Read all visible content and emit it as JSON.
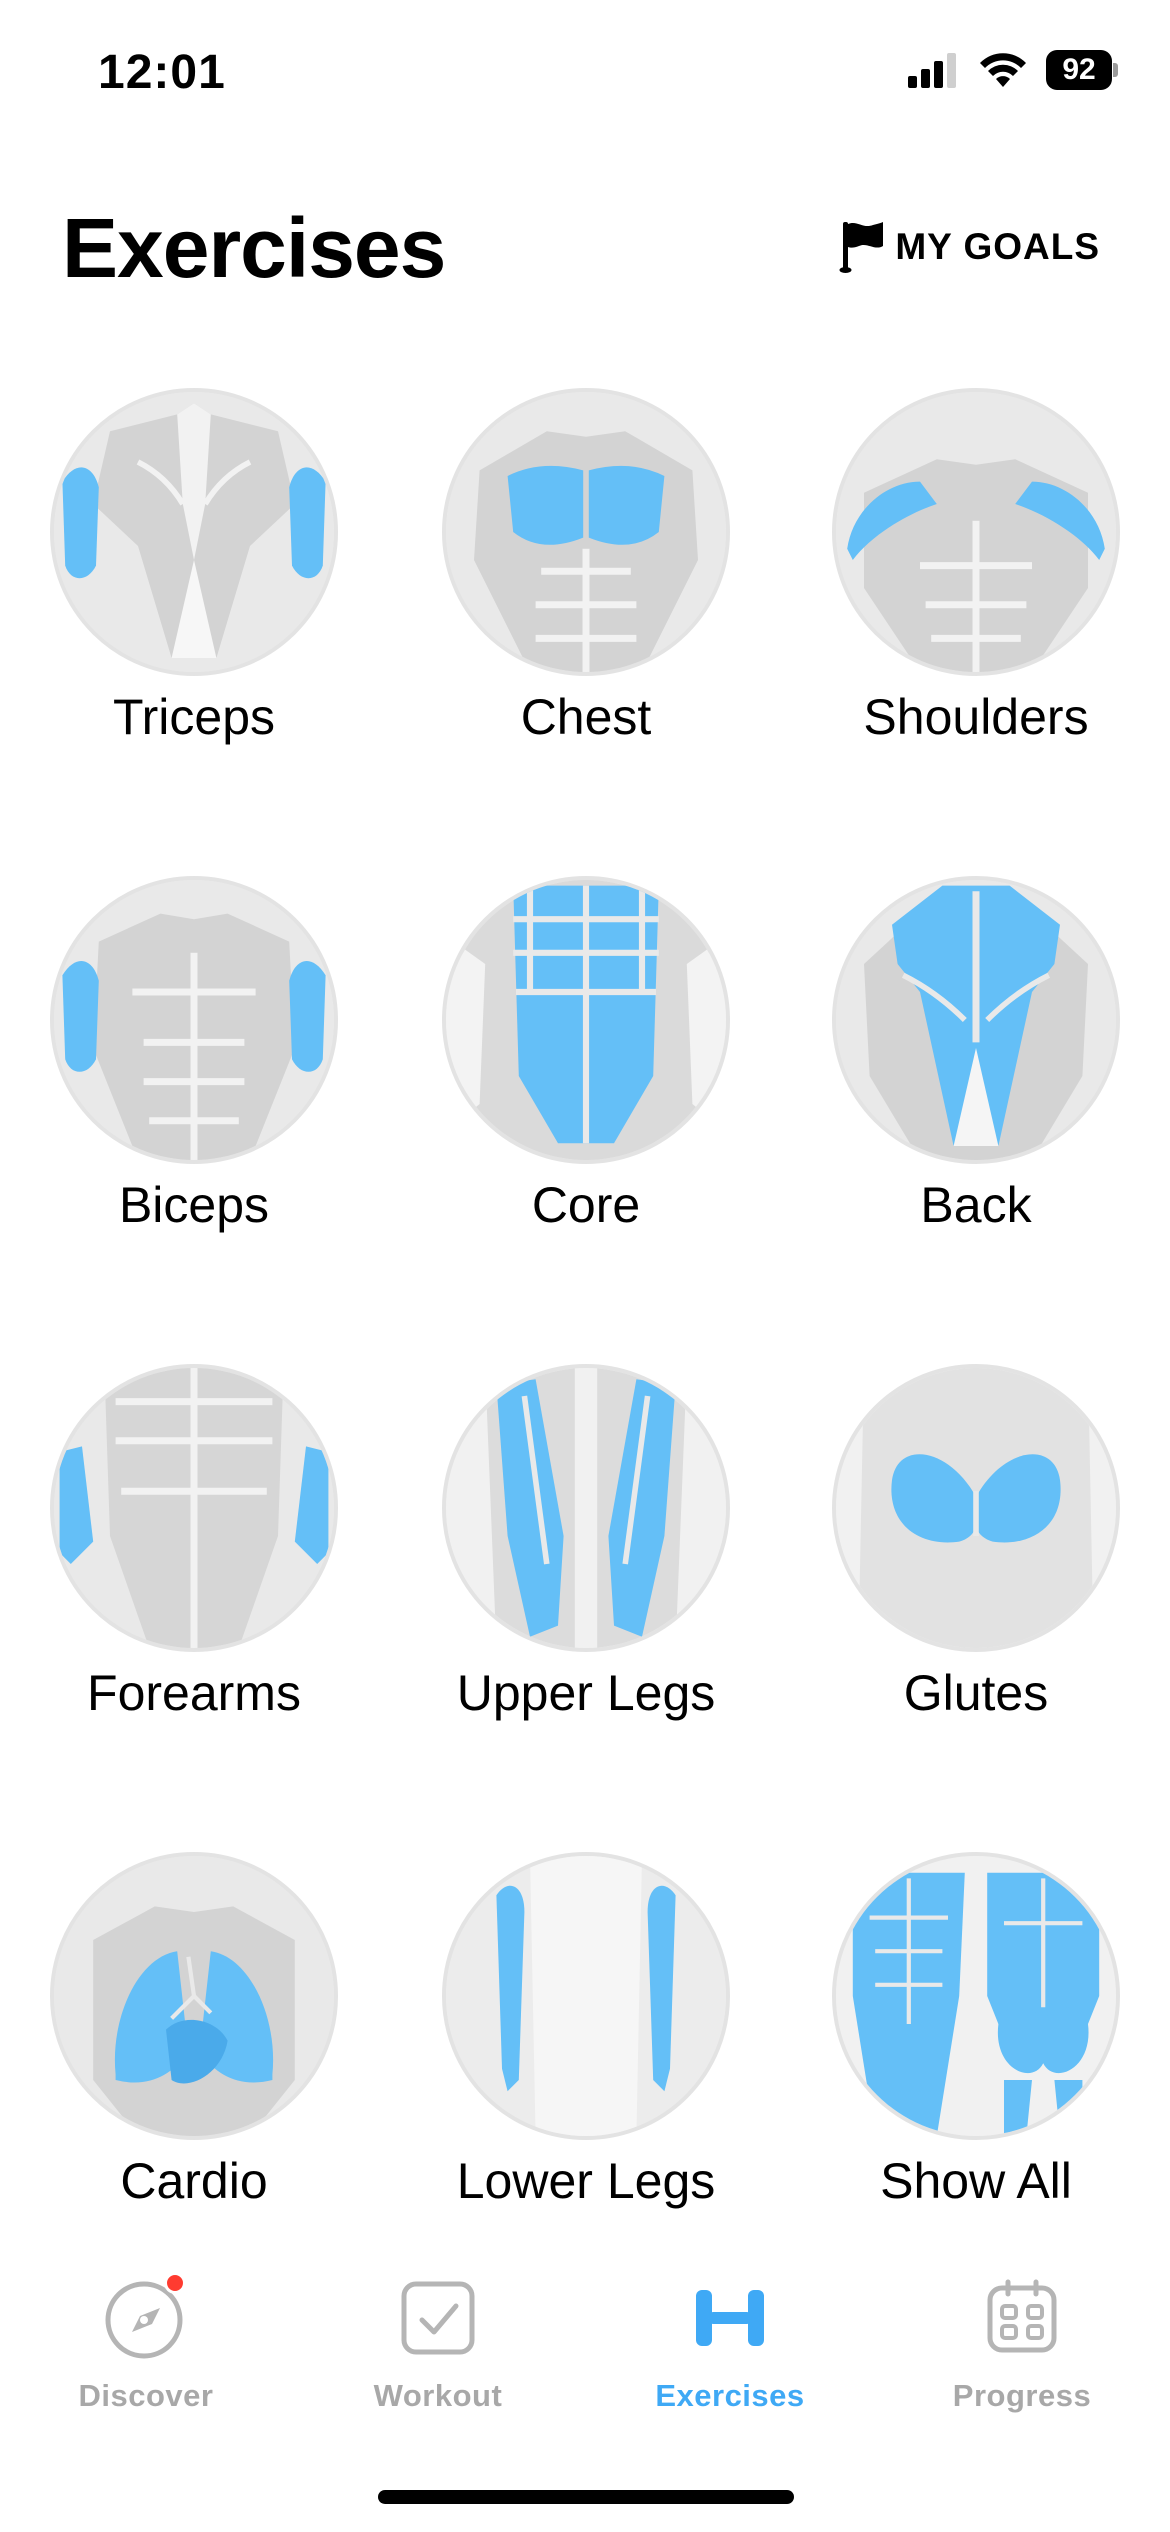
{
  "status": {
    "time": "12:01",
    "battery": "92"
  },
  "header": {
    "title": "Exercises",
    "goals_label": "MY GOALS"
  },
  "exercises": [
    {
      "label": "Triceps",
      "icon": "triceps-icon"
    },
    {
      "label": "Chest",
      "icon": "chest-icon"
    },
    {
      "label": "Shoulders",
      "icon": "shoulders-icon"
    },
    {
      "label": "Biceps",
      "icon": "biceps-icon"
    },
    {
      "label": "Core",
      "icon": "core-icon"
    },
    {
      "label": "Back",
      "icon": "back-icon"
    },
    {
      "label": "Forearms",
      "icon": "forearms-icon"
    },
    {
      "label": "Upper Legs",
      "icon": "upper-legs-icon"
    },
    {
      "label": "Glutes",
      "icon": "glutes-icon"
    },
    {
      "label": "Cardio",
      "icon": "cardio-icon"
    },
    {
      "label": "Lower Legs",
      "icon": "lower-legs-icon"
    },
    {
      "label": "Show All",
      "icon": "show-all-icon"
    }
  ],
  "tabs": [
    {
      "label": "Discover",
      "icon": "compass-icon",
      "active": false
    },
    {
      "label": "Workout",
      "icon": "checkbox-icon",
      "active": false
    },
    {
      "label": "Exercises",
      "icon": "dumbbell-icon",
      "active": true
    },
    {
      "label": "Progress",
      "icon": "calendar-icon",
      "active": false
    }
  ],
  "colors": {
    "accent": "#3fa9f5",
    "muscle_highlight": "#64bff7",
    "muscle_gray": "#d6d6d6",
    "notification": "#ff3b30"
  }
}
